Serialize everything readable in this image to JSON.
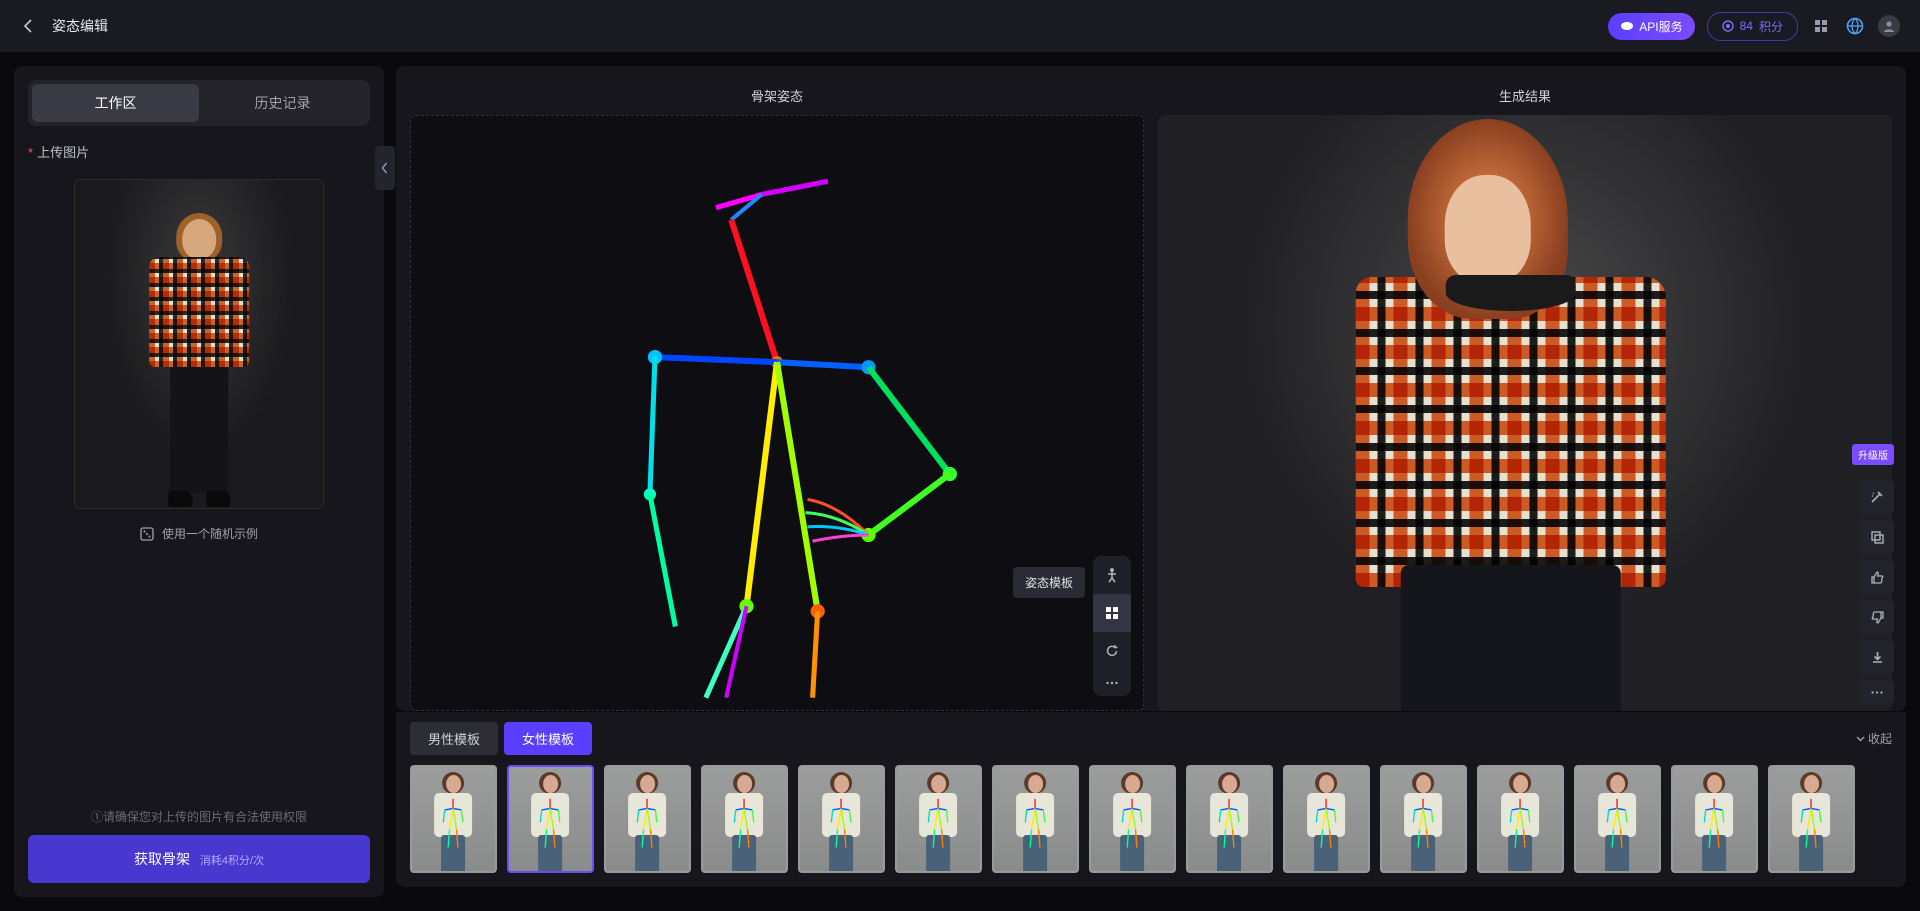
{
  "header": {
    "title": "姿态编辑",
    "api_label": "API服务",
    "credits_value": "84",
    "credits_unit": "积分"
  },
  "sidebar": {
    "tabs": {
      "workspace": "工作区",
      "history": "历史记录"
    },
    "upload_label": "上传图片",
    "random_example": "使用一个随机示例",
    "permission_note": "①请确保您对上传的图片有合法使用权限",
    "action_label": "获取骨架",
    "action_cost": "消耗4积分/次"
  },
  "panels": {
    "skeleton_title": "骨架姿态",
    "result_title": "生成结果",
    "pose_template_tooltip": "姿态模板",
    "upgrade_badge": "升级版"
  },
  "templates": {
    "male_label": "男性模板",
    "female_label": "女性模板",
    "collapse_label": "收起",
    "count": 15
  }
}
